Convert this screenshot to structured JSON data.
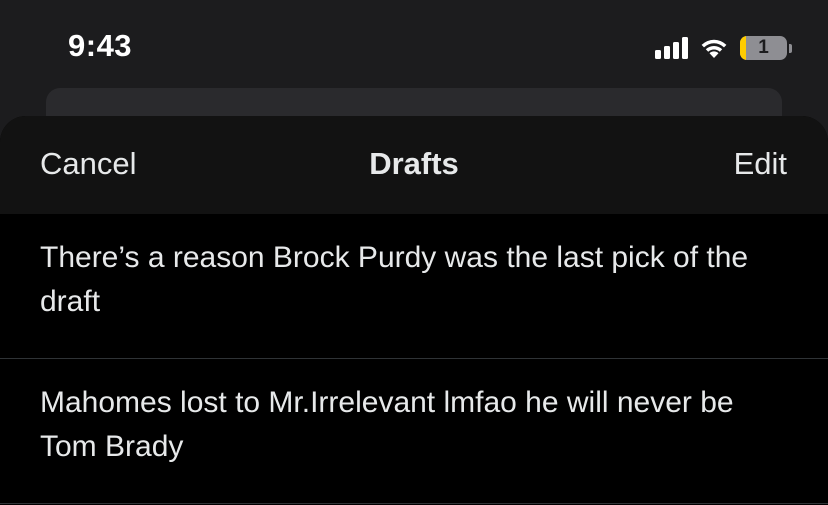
{
  "status_bar": {
    "time": "9:43",
    "battery_level": "1",
    "battery_fraction": 0.12,
    "icons": [
      "signal-icon",
      "wifi-icon",
      "battery-icon"
    ]
  },
  "nav": {
    "cancel_label": "Cancel",
    "title": "Drafts",
    "edit_label": "Edit"
  },
  "drafts": [
    {
      "text": "There’s a reason Brock Purdy was the last pick of the draft"
    },
    {
      "text": "Mahomes lost to Mr.Irrelevant lmfao he will never be Tom Brady"
    }
  ],
  "colors": {
    "background": "#000000",
    "status_bar_bg": "#1c1c1e",
    "nav_bg": "#121212",
    "text": "#e7e9ea",
    "divider": "#2f3336",
    "battery_low": "#ffcc00"
  }
}
